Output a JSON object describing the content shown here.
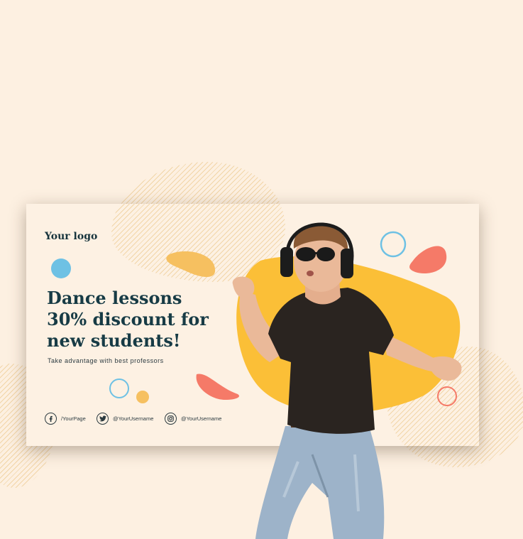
{
  "banner": {
    "logo": "Your logo",
    "headline": [
      "Dance lessons",
      "30% discount for",
      "new students!"
    ],
    "subtitle": "Take advantage with best professors"
  },
  "social": [
    {
      "icon": "facebook-icon",
      "label": "/YourPage"
    },
    {
      "icon": "twitter-icon",
      "label": "@YourUsername"
    },
    {
      "icon": "instagram-icon",
      "label": "@YourUsername"
    }
  ],
  "colors": {
    "background": "#fdf0e1",
    "card": "#fdf1e3",
    "text": "#173b45",
    "yellow": "#fbbf37",
    "orange_blob": "#f6c060",
    "coral": "#f57a68",
    "blue": "#6ec1e4"
  }
}
